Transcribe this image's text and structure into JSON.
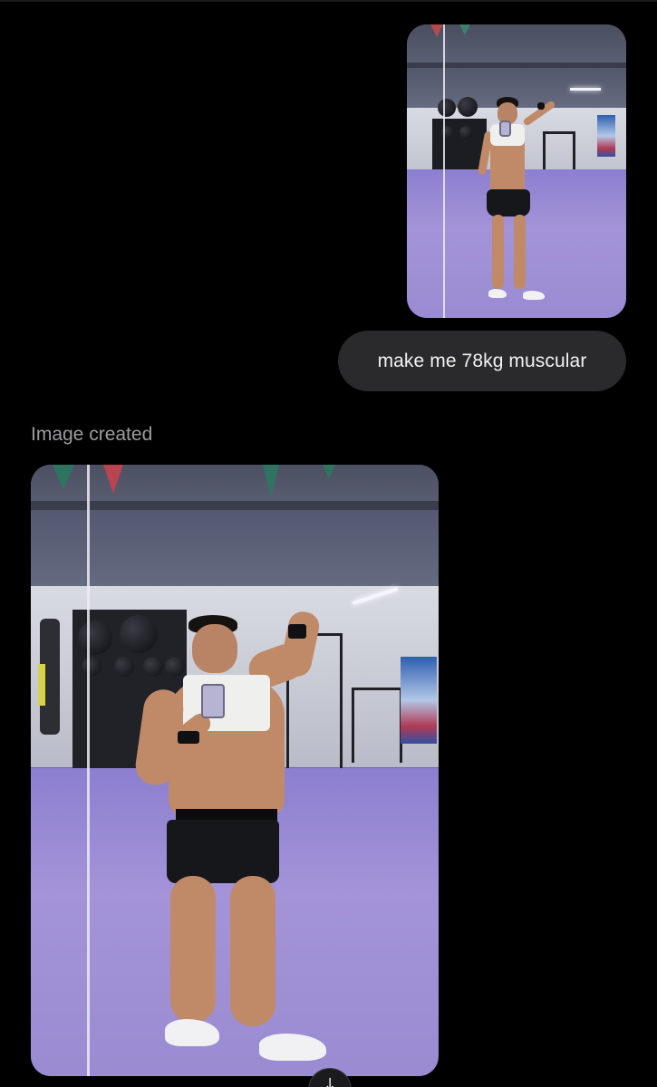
{
  "conversation": {
    "user_message": {
      "attachment_icon": "photo-thumbnail",
      "text": "make me 78kg muscular"
    },
    "assistant_message": {
      "status": "Image created",
      "result_icon": "generated-image"
    }
  },
  "controls": {
    "scroll_down_glyph": "↓",
    "scroll_down_icon": "arrow-down-icon"
  },
  "colors": {
    "background": "#000000",
    "bubble": "#2a2a2c",
    "bubble_text": "#f2f2f2",
    "status_text": "#9c9c9f",
    "gym_floor": "#9a8bd2"
  }
}
